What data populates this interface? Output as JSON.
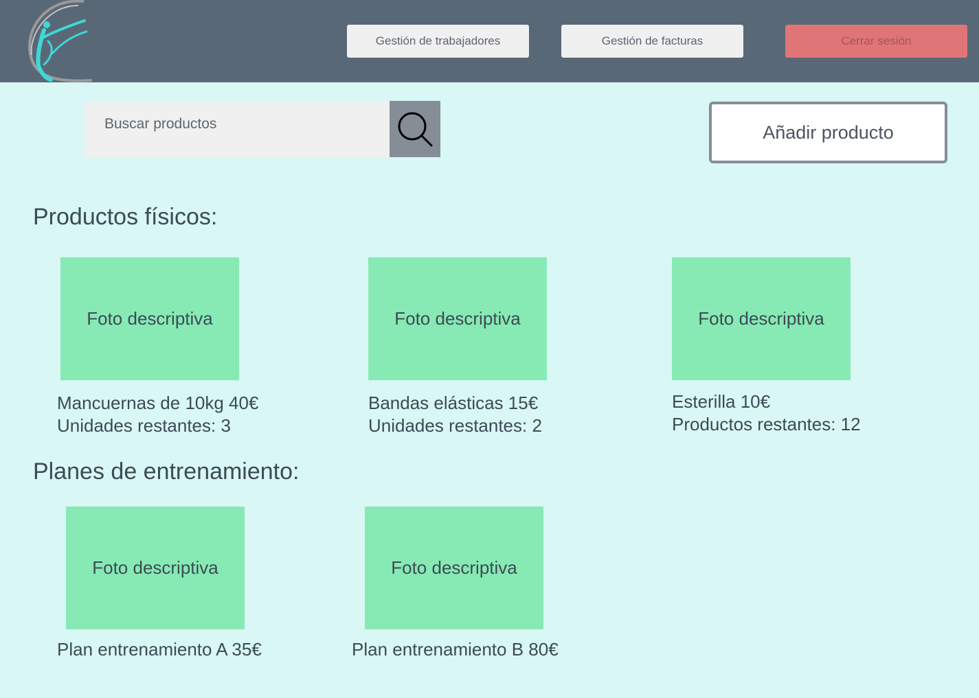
{
  "header": {
    "nav": {
      "workers": "Gestión de trabajadores",
      "invoices": "Gestión de facturas",
      "logout": "Cerrar sesión"
    }
  },
  "toolbar": {
    "search_placeholder": "Buscar productos",
    "add_label": "Añadir producto"
  },
  "sections": {
    "physical": {
      "title": "Productos físicos:",
      "items": [
        {
          "photo": "Foto descriptiva",
          "line1": "Mancuernas de 10kg 40€",
          "line2": "Unidades restantes: 3"
        },
        {
          "photo": "Foto descriptiva",
          "line1": "Bandas elásticas 15€",
          "line2": "Unidades restantes: 2"
        },
        {
          "photo": "Foto descriptiva",
          "line1": "Esterilla 10€",
          "line2": "Productos restantes: 12"
        }
      ]
    },
    "plans": {
      "title": "Planes de entrenamiento:",
      "items": [
        {
          "photo": "Foto descriptiva",
          "line1": "Plan entrenamiento A 35€"
        },
        {
          "photo": "Foto descriptiva",
          "line1": "Plan entrenamiento B 80€"
        }
      ]
    }
  },
  "icons": {
    "logo": "logo-icon",
    "search": "search-icon"
  },
  "colors": {
    "header_bg": "#596877",
    "page_bg": "#d8f7f5",
    "photo_bg": "#87eab4",
    "logout_bg": "#e07577",
    "accent": "#3dd9d6"
  }
}
